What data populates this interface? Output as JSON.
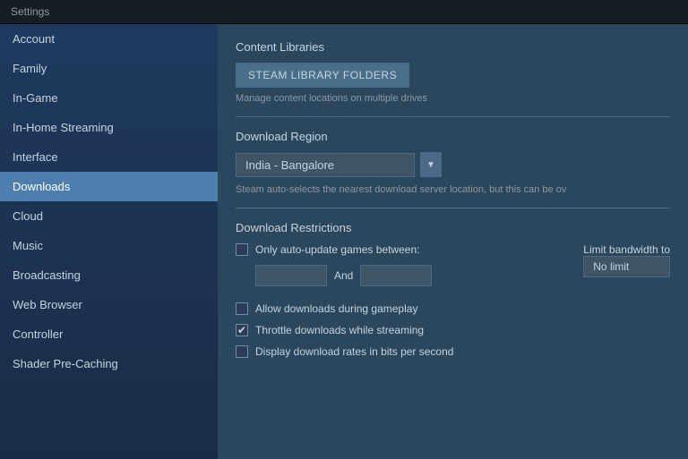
{
  "titleBar": {
    "label": "Settings"
  },
  "sidebar": {
    "items": [
      {
        "id": "account",
        "label": "Account",
        "active": false
      },
      {
        "id": "family",
        "label": "Family",
        "active": false
      },
      {
        "id": "in-game",
        "label": "In-Game",
        "active": false
      },
      {
        "id": "in-home-streaming",
        "label": "In-Home Streaming",
        "active": false
      },
      {
        "id": "interface",
        "label": "Interface",
        "active": false
      },
      {
        "id": "downloads",
        "label": "Downloads",
        "active": true
      },
      {
        "id": "cloud",
        "label": "Cloud",
        "active": false
      },
      {
        "id": "music",
        "label": "Music",
        "active": false
      },
      {
        "id": "broadcasting",
        "label": "Broadcasting",
        "active": false
      },
      {
        "id": "web-browser",
        "label": "Web Browser",
        "active": false
      },
      {
        "id": "controller",
        "label": "Controller",
        "active": false
      },
      {
        "id": "shader-pre-caching",
        "label": "Shader Pre-Caching",
        "active": false
      }
    ]
  },
  "content": {
    "contentLibraries": {
      "title": "Content Libraries",
      "button": "STEAM LIBRARY FOLDERS",
      "description": "Manage content locations on multiple drives"
    },
    "downloadRegion": {
      "title": "Download Region",
      "selected": "India - Bangalore",
      "description": "Steam auto-selects the nearest download server location, but this can be ov"
    },
    "downloadRestrictions": {
      "title": "Download Restrictions",
      "autoUpdateLabel": "Only auto-update games between:",
      "andLabel": "And",
      "limitBandwidthLabel": "Limit bandwidth to",
      "limitBandwidthValue": "No limit",
      "allowDownloadsLabel": "Allow downloads during gameplay",
      "throttleDownloadsLabel": "Throttle downloads while streaming",
      "displayRatesLabel": "Display download rates in bits per second",
      "allowDownloadsChecked": false,
      "throttleDownloadsChecked": true,
      "displayRatesChecked": false,
      "autoUpdateChecked": false
    }
  }
}
